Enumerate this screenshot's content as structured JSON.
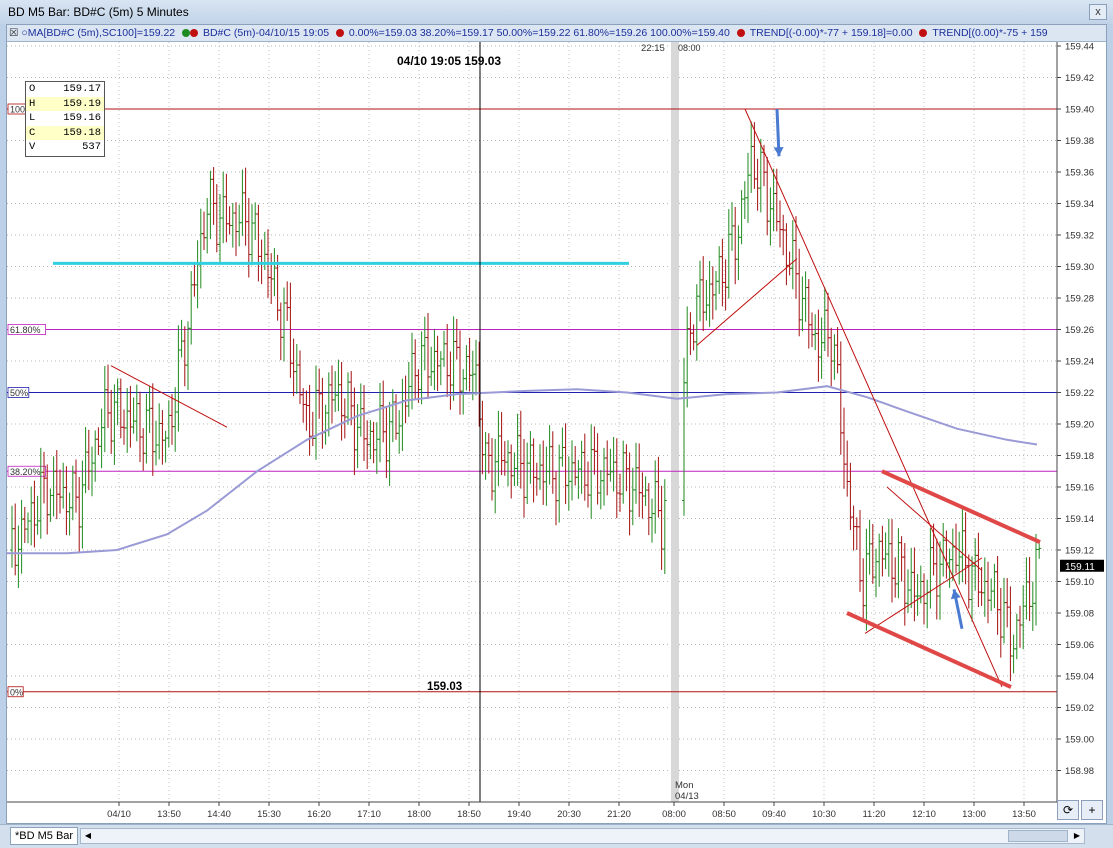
{
  "window": {
    "title": "BD M5 Bar: BD#C (5m) 5 Minutes",
    "close_label": "x"
  },
  "study_bar": {
    "ma": "MA[BD#C (5m),SC100]=159.22",
    "symbol": "BD#C (5m)-04/10/15 19:05",
    "fib": "0.00%=159.03 38.20%=159.17 50.00%=159.22 61.80%=159.26 100.00%=159.40",
    "trend1": "TREND[(-0.00)*-77 + 159.18]=0.00",
    "trend2": "TREND[(0.00)*-75 + 159"
  },
  "ohlc": [
    {
      "k": "O",
      "v": "159.17"
    },
    {
      "k": "H",
      "v": "159.19"
    },
    {
      "k": "L",
      "v": "159.16"
    },
    {
      "k": "C",
      "v": "159.18"
    },
    {
      "k": "V",
      "v": "537"
    }
  ],
  "crosshair_label": "04/10 19:05  159.03",
  "session_labels": {
    "time": "22:15",
    "open": "08:00"
  },
  "mon_label": {
    "day": "Mon",
    "date": "04/13"
  },
  "price_line_label": "159.03",
  "last_price": "159.11",
  "fib_labels": {
    "p100": "100",
    "p618": "61.80%",
    "p50": "50%",
    "p382": "38.20%",
    "p0": "0%"
  },
  "colors": {
    "up": "#1f8a1f",
    "down": "#a31010",
    "fib_magenta": "#c020c0",
    "ma_line": "#9a9ad6",
    "cyan": "#30d0e0",
    "blue_line": "#2020b0",
    "channel": "#e04848"
  },
  "bottom": {
    "tab": "*BD M5 Bar",
    "btn_refresh": "⟳",
    "btn_plus": "+"
  },
  "chart_data": {
    "type": "ohlc",
    "title": "BD M5 Bar: BD#C (5m) 5 Minutes",
    "ylim": [
      158.96,
      159.44
    ],
    "y_ticks": [
      "159.44",
      "159.42",
      "159.40",
      "159.38",
      "159.36",
      "159.34",
      "159.32",
      "159.30",
      "159.28",
      "159.26",
      "159.24",
      "159.22",
      "159.20",
      "159.18",
      "159.16",
      "159.14",
      "159.12",
      "159.10",
      "159.08",
      "159.06",
      "159.04",
      "159.02",
      "159.00",
      "158.98"
    ],
    "x_ticks": [
      "04/10",
      "13:50",
      "14:40",
      "15:30",
      "16:20",
      "17:10",
      "18:00",
      "18:50",
      "19:40",
      "20:30",
      "21:20",
      "08:00",
      "08:50",
      "09:40",
      "10:30",
      "11:20",
      "12:10",
      "13:00",
      "13:50"
    ],
    "fib_levels": {
      "0%": 159.03,
      "38.2%": 159.17,
      "50%": 159.22,
      "61.8%": 159.26,
      "100%": 159.4
    },
    "moving_average": "MA[BD#C (5m),SC100]=159.22",
    "last_price": 159.11,
    "crosshair": {
      "time": "04/10 19:05",
      "price": 159.03
    }
  }
}
